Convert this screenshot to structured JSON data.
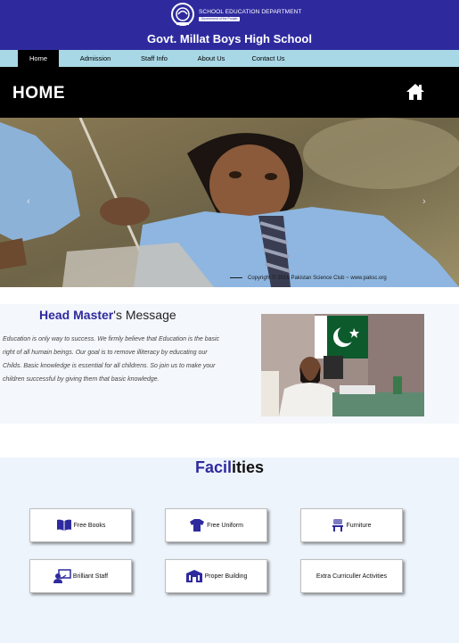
{
  "header": {
    "department": "SCHOOL EDUCATION DEPARTMENT",
    "department_sub": "Government of the Punjab",
    "school_name": "Govt. Millat Boys High School"
  },
  "nav": {
    "items": [
      {
        "label": "Home",
        "active": true
      },
      {
        "label": "Admission"
      },
      {
        "label": "Staff Info"
      },
      {
        "label": "About Us"
      },
      {
        "label": "Contact Us"
      }
    ]
  },
  "page": {
    "title": "HOME",
    "home_icon": "home-icon"
  },
  "hero": {
    "copyright": "Copyright © 2016 Pakistan Science Club ~ www.paksc.org",
    "prev": "‹",
    "next": "›"
  },
  "headmaster": {
    "heading_highlight": "Head Master",
    "heading_rest": "'s Message",
    "message": "Education is only way to success. We firmly believe that Education is the basic right of all humain beings. Our goal is to remove illiteracy by educating our Childs. Basic knowledge is essential for all childrens. So join us to make your children successful by giving them that basic knowledge."
  },
  "facilities": {
    "heading_highlight": "Facil",
    "heading_rest": "ities",
    "items": [
      {
        "label": "Free Books",
        "icon": "book-icon"
      },
      {
        "label": "Free Uniform",
        "icon": "shirt-icon"
      },
      {
        "label": "Furniture",
        "icon": "chair-icon"
      },
      {
        "label": "Brilliant Staff",
        "icon": "teacher-icon"
      },
      {
        "label": "Proper Building",
        "icon": "building-icon"
      },
      {
        "label": "Extra Curriculler Activities",
        "icon": ""
      }
    ]
  },
  "colors": {
    "brand": "#2e2a9e",
    "nav": "#a8d7e6",
    "page_bar": "#000000"
  }
}
